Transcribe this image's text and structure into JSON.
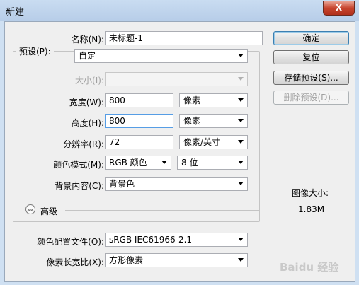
{
  "window": {
    "title": "新建",
    "close_glyph": "X"
  },
  "name": {
    "label": "名称(N):",
    "value": "未标题-1"
  },
  "preset": {
    "label": "预设(P):",
    "value": "自定"
  },
  "size": {
    "label": "大小(I):",
    "value": ""
  },
  "width": {
    "label": "宽度(W):",
    "value": "800",
    "unit": "像素"
  },
  "height": {
    "label": "高度(H):",
    "value": "800",
    "unit": "像素"
  },
  "resolution": {
    "label": "分辨率(R):",
    "value": "72",
    "unit": "像素/英寸"
  },
  "color_mode": {
    "label": "颜色模式(M):",
    "mode": "RGB 颜色",
    "depth": "8 位"
  },
  "background": {
    "label": "背景内容(C):",
    "value": "背景色"
  },
  "advanced": {
    "label": "高级",
    "icon": "double-chevron-up-icon"
  },
  "color_profile": {
    "label": "颜色配置文件(O):",
    "value": "sRGB IEC61966-2.1"
  },
  "pixel_aspect": {
    "label": "像素长宽比(X):",
    "value": "方形像素"
  },
  "buttons": {
    "ok": "确定",
    "reset": "复位",
    "save_preset": "存储预设(S)...",
    "delete_preset": "删除预设(D)..."
  },
  "image_size": {
    "label": "图像大小:",
    "value": "1.83M"
  },
  "watermark": "Baidu 经验"
}
